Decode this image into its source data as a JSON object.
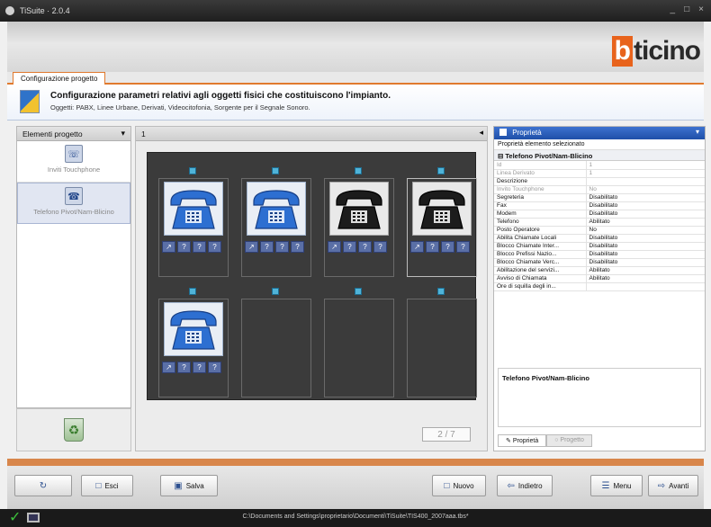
{
  "window": {
    "title": "TiSuite · 2.0.4",
    "controls": [
      "_",
      "□",
      "×"
    ]
  },
  "brand": {
    "logo_accent": "b",
    "logo_rest": "ticino",
    "accent_color": "#e8631c"
  },
  "tabs": [
    {
      "label": "Configurazione progetto"
    }
  ],
  "header": {
    "title": "Configurazione parametri relativi agli oggetti fisici che costituiscono l'impianto.",
    "subtitle": "Oggetti: PABX, Linee Urbane, Derivati, Videocitofonia, Sorgente per il Segnale Sonoro."
  },
  "left_panel": {
    "title": "Elementi progetto",
    "items": [
      {
        "label": "Inviti Touchphone",
        "icon": "phone-screen-icon",
        "selected": false
      },
      {
        "label": "Telefono Pivot/Nam-Blicino",
        "icon": "phone-device-icon",
        "selected": true
      }
    ]
  },
  "center_panel": {
    "title": "1",
    "slots": [
      {
        "filled": true,
        "color": "blue",
        "selected": false
      },
      {
        "filled": true,
        "color": "blue",
        "selected": false
      },
      {
        "filled": true,
        "color": "black",
        "selected": false
      },
      {
        "filled": true,
        "color": "black",
        "selected": true
      },
      {
        "filled": true,
        "color": "blue",
        "selected": false
      },
      {
        "filled": false
      },
      {
        "filled": false
      },
      {
        "filled": false
      }
    ],
    "badges": [
      "↗",
      "?",
      "?",
      "?"
    ],
    "pager": "2 / 7"
  },
  "properties": {
    "title": "Proprietà",
    "subtitle": "Proprietà elemento selezionato",
    "group": "Telefono Pivot/Nam-Blicino",
    "rows": [
      {
        "key": "Id",
        "value": "1",
        "dim": true
      },
      {
        "key": "Linea Derivato",
        "value": "1",
        "dim": true
      },
      {
        "key": "Descrizione",
        "value": "",
        "dim": false
      },
      {
        "key": "Invito Touchphone",
        "value": "No",
        "dim": true
      },
      {
        "key": "Segreteria",
        "value": "Disabilitato",
        "dim": false
      },
      {
        "key": "Fax",
        "value": "Disabilitato",
        "dim": false
      },
      {
        "key": "Modem",
        "value": "Disabilitato",
        "dim": false
      },
      {
        "key": "Telefono",
        "value": "Abilitato",
        "dim": false
      },
      {
        "key": "Posto Operatore",
        "value": "No",
        "dim": false
      },
      {
        "key": "Abilita Chiamate Locali",
        "value": "Disabilitato",
        "dim": false
      },
      {
        "key": "Blocco Chiamate Inter...",
        "value": "Disabilitato",
        "dim": false
      },
      {
        "key": "Blocco Prefissi Nazio...",
        "value": "Disabilitato",
        "dim": false
      },
      {
        "key": "Blocco Chiamate Verc...",
        "value": "Disabilitato",
        "dim": false
      },
      {
        "key": "Abilitazione del servizi...",
        "value": "Abilitato",
        "dim": false
      },
      {
        "key": "Avviso di Chiamata",
        "value": "Abilitato",
        "dim": false
      },
      {
        "key": "Ore di squilla degli in...",
        "value": "",
        "dim": false
      }
    ],
    "description_title": "Telefono Pivot/Nam-Blicino",
    "tabs": [
      {
        "label": "Proprietà",
        "active": true
      },
      {
        "label": "Progetto",
        "active": false
      }
    ]
  },
  "buttons": {
    "refresh": "",
    "edit": "Esci",
    "save": "Salva",
    "new": "Nuovo",
    "back": "Indietro",
    "menu": "Menu",
    "next": "Avanti"
  },
  "status": {
    "path": "C:\\Documents and Settings\\proprietario\\Documenti\\TiSuite\\TIS400_2007aaa.tbs*"
  }
}
